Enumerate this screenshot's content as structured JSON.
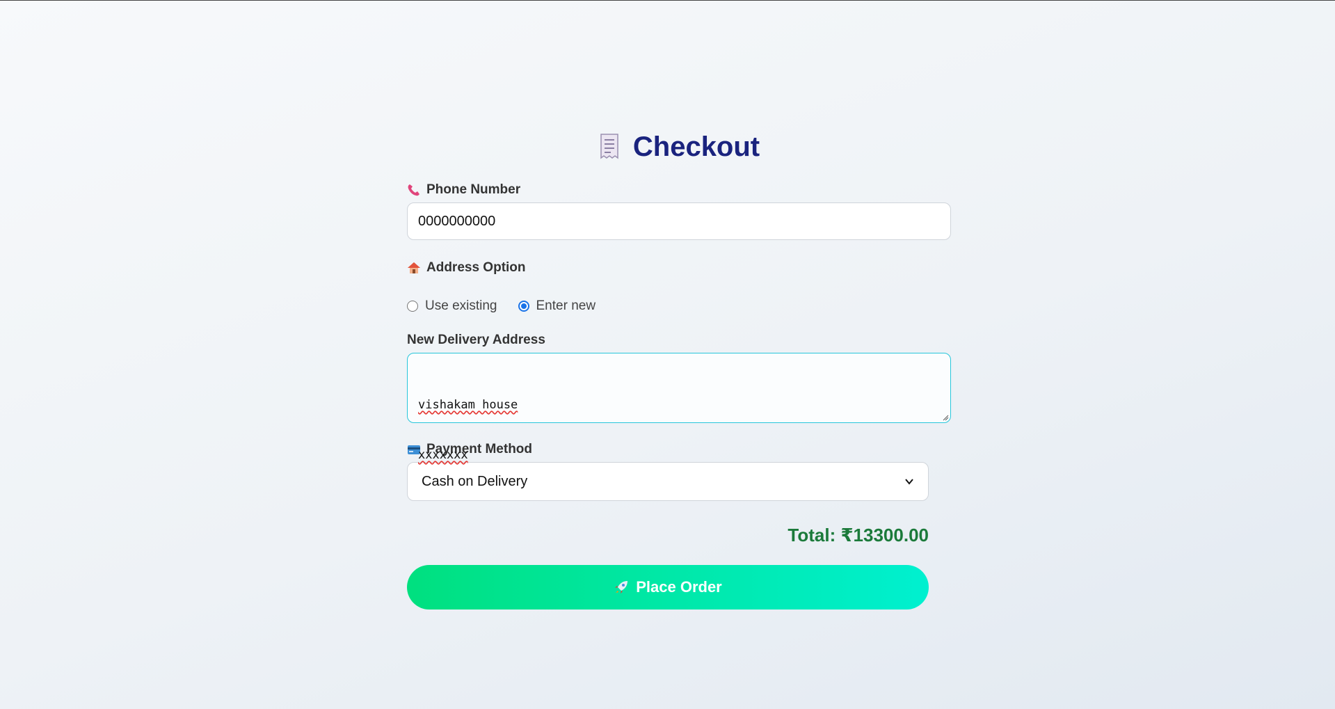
{
  "page": {
    "title": "Checkout",
    "title_icon": "receipt-icon"
  },
  "phone": {
    "label": "Phone Number",
    "icon": "telephone-icon",
    "value": "0000000000"
  },
  "address_option": {
    "label": "Address Option",
    "icon": "house-icon",
    "options": [
      {
        "label": "Use existing",
        "checked": false
      },
      {
        "label": "Enter new",
        "checked": true
      }
    ]
  },
  "new_address": {
    "label": "New Delivery Address",
    "lines": [
      "vishakam house",
      "xxxxxxx"
    ]
  },
  "payment": {
    "label": "Payment Method",
    "icon": "credit-card-icon",
    "selected": "Cash on Delivery"
  },
  "total": {
    "text": "Total: ₹13300.00"
  },
  "place_order": {
    "label": "Place Order",
    "icon": "rocket-icon"
  },
  "colors": {
    "title": "#1a237e",
    "total": "#1b7a3a",
    "button_start": "#00e07f",
    "button_end": "#00f0d0",
    "focus_border": "#26c6da",
    "radio_accent": "#1a73e8"
  }
}
